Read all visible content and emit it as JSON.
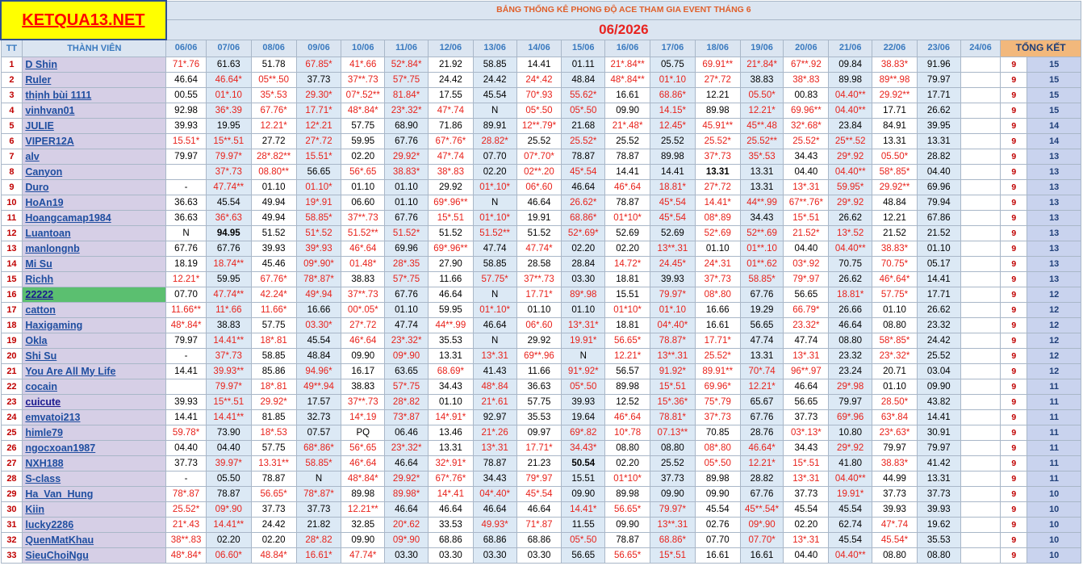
{
  "logo_text": "KETQUA13.NET",
  "title": "BẢNG THỐNG KÊ PHONG ĐỘ ACE THAM GIA EVENT THÁNG 6",
  "month": "06/2026",
  "headers": {
    "tt": "TT",
    "member": "THÀNH VIÊN",
    "dates": [
      "06/06",
      "07/06",
      "08/06",
      "09/06",
      "10/06",
      "11/06",
      "12/06",
      "13/06",
      "14/06",
      "15/06",
      "16/06",
      "17/06",
      "18/06",
      "19/06",
      "20/06",
      "21/06",
      "22/06",
      "23/06",
      "24/06"
    ],
    "total": "TỔNG KẾT"
  },
  "colors": {
    "logo_bg": "#ffff00",
    "logo_text": "#ff0000",
    "header_bg": "#dbe5f1",
    "name_bg": "#d6cfe6",
    "highlight_bg": "#5bbf70",
    "red_value": "#e8221b",
    "total_header_bg": "#f2b87c"
  },
  "rows": [
    {
      "tt": "1",
      "name": "D Shin",
      "values": [
        "71*.76",
        "61.63",
        "51.78",
        "67.85*",
        "41*.66",
        "52*.84*",
        "21.92",
        "58.85",
        "14.41",
        "01.11",
        "21*.84**",
        "05.75",
        "69.91**",
        "21*.84*",
        "67**.92",
        "09.84",
        "38.83*",
        "91.96",
        ""
      ],
      "t1": "9",
      "t2": "15"
    },
    {
      "tt": "2",
      "name": "Ruler",
      "values": [
        "46.64",
        "46.64*",
        "05**.50",
        "37.73",
        "37**.73",
        "57*.75",
        "24.42",
        "24.42",
        "24*.42",
        "48.84",
        "48*.84**",
        "01*.10",
        "27*.72",
        "38.83",
        "38*.83",
        "89.98",
        "89**.98",
        "79.97",
        ""
      ],
      "t1": "9",
      "t2": "15"
    },
    {
      "tt": "3",
      "name": "thịnh bùi 1111",
      "values": [
        "00.55",
        "01*.10",
        "35*.53",
        "29.30*",
        "07*.52**",
        "81.84*",
        "17.55",
        "45.54",
        "70*.93",
        "55.62*",
        "16.61",
        "68.86*",
        "12.21",
        "05.50*",
        "00.83",
        "04.40**",
        "29.92**",
        "17.71",
        ""
      ],
      "t1": "9",
      "t2": "15"
    },
    {
      "tt": "4",
      "name": "vinhvan01",
      "values": [
        "92.98",
        "36*.39",
        "67.76*",
        "17.71*",
        "48*.84*",
        "23*.32*",
        "47*.74",
        "N",
        "05*.50",
        "05*.50",
        "09.90",
        "14.15*",
        "89.98",
        "12.21*",
        "69.96**",
        "04.40**",
        "17.71",
        "26.62",
        ""
      ],
      "t1": "9",
      "t2": "15"
    },
    {
      "tt": "5",
      "name": "JULIE",
      "values": [
        "39.93",
        "19.95",
        "12.21*",
        "12*.21",
        "57.75",
        "68.90",
        "71.86",
        "89.91",
        "12**.79*",
        "21.68",
        "21*.48*",
        "12.45*",
        "45.91**",
        "45**.48",
        "32*.68*",
        "23.84",
        "84.91",
        "39.95",
        ""
      ],
      "t1": "9",
      "t2": "14"
    },
    {
      "tt": "6",
      "name": "VIPER12A",
      "values": [
        "15.51*",
        "15**.51",
        "27.72",
        "27*.72",
        "59.95",
        "67.76",
        "67*.76*",
        "28.82*",
        "25.52",
        "25.52*",
        "25.52",
        "25.52",
        "25.52*",
        "25.52**",
        "25.52*",
        "25**.52",
        "13.31",
        "13.31",
        ""
      ],
      "t1": "9",
      "t2": "14"
    },
    {
      "tt": "7",
      "name": "alv",
      "values": [
        "79.97",
        "79.97*",
        "28*.82**",
        "15.51*",
        "02.20",
        "29.92*",
        "47*.74",
        "07.70",
        "07*.70*",
        "78.87",
        "78.87",
        "89.98",
        "37*.73",
        "35*.53",
        "34.43",
        "29*.92",
        "05.50*",
        "28.82",
        ""
      ],
      "t1": "9",
      "t2": "13"
    },
    {
      "tt": "8",
      "name": "Canyon",
      "values": [
        "",
        "37*.73",
        "08.80**",
        "56.65",
        "56*.65",
        "38.83*",
        "38*.83",
        "02.20",
        "02**.20",
        "45*.54",
        "14.41",
        "14.41",
        "13.31",
        "13.31",
        "04.40",
        "04.40**",
        "58*.85*",
        "04.40",
        ""
      ],
      "t1": "9",
      "t2": "13"
    },
    {
      "tt": "9",
      "name": "Duro",
      "values": [
        "-",
        "47.74**",
        "01.10",
        "01.10*",
        "01.10",
        "01.10",
        "29.92",
        "01*.10*",
        "06*.60",
        "46.64",
        "46*.64",
        "18.81*",
        "27*.72",
        "13.31",
        "13*.31",
        "59.95*",
        "29.92**",
        "69.96",
        ""
      ],
      "t1": "9",
      "t2": "13"
    },
    {
      "tt": "10",
      "name": "HoAn19",
      "values": [
        "36.63",
        "45.54",
        "49.94",
        "19*.91",
        "06.60",
        "01.10",
        "69*.96**",
        "N",
        "46.64",
        "26.62*",
        "78.87",
        "45*.54",
        "14.41*",
        "44**.99",
        "67**.76*",
        "29*.92",
        "48.84",
        "79.94",
        ""
      ],
      "t1": "9",
      "t2": "13"
    },
    {
      "tt": "11",
      "name": "Hoangcamap1984",
      "values": [
        "36.63",
        "36*.63",
        "49.94",
        "58.85*",
        "37**.73",
        "67.76",
        "15*.51",
        "01*.10*",
        "19.91",
        "68.86*",
        "01*10*",
        "45*.54",
        "08*.89",
        "34.43",
        "15*.51",
        "26.62",
        "12.21",
        "67.86",
        ""
      ],
      "t1": "9",
      "t2": "13"
    },
    {
      "tt": "12",
      "name": "Luantoan",
      "values": [
        "N",
        "94.95",
        "51.52",
        "51*.52",
        "51.52**",
        "51.52*",
        "51.52",
        "51.52**",
        "51.52",
        "52*.69*",
        "52.69",
        "52.69",
        "52*.69",
        "52**.69",
        "21.52*",
        "13*.52",
        "21.52",
        "21.52",
        ""
      ],
      "t1": "9",
      "t2": "13"
    },
    {
      "tt": "13",
      "name": "manlongnb",
      "values": [
        "67.76",
        "67.76",
        "39.93",
        "39*.93",
        "46*.64",
        "69.96",
        "69*.96**",
        "47.74",
        "47.74*",
        "02.20",
        "02.20",
        "13**.31",
        "01.10",
        "01**.10",
        "04.40",
        "04.40**",
        "38.83*",
        "01.10",
        ""
      ],
      "t1": "9",
      "t2": "13"
    },
    {
      "tt": "14",
      "name": "Mi Su",
      "values": [
        "18.19",
        "18.74**",
        "45.46",
        "09*.90*",
        "01.48*",
        "28*.35",
        "27.90",
        "58.85",
        "28.58",
        "28.84",
        "14.72*",
        "24.45*",
        "24*.31",
        "01**.62",
        "03*.92",
        "70.75",
        "70.75*",
        "05.17",
        ""
      ],
      "t1": "9",
      "t2": "13"
    },
    {
      "tt": "15",
      "name": "Richh",
      "values": [
        "12.21*",
        "59.95",
        "67.76*",
        "78*.87*",
        "38.83",
        "57*.75",
        "11.66",
        "57.75*",
        "37**.73",
        "03.30",
        "18.81",
        "39.93",
        "37*.73",
        "58.85*",
        "79*.97",
        "26.62",
        "46*.64*",
        "14.41",
        ""
      ],
      "t1": "9",
      "t2": "13"
    },
    {
      "tt": "16",
      "name": "22222",
      "values": [
        "07.70",
        "47.74**",
        "42.24*",
        "49*.94",
        "37**.73",
        "67.76",
        "46.64",
        "N",
        "17.71*",
        "89*.98",
        "15.51",
        "79.97*",
        "08*.80",
        "67.76",
        "56.65",
        "18.81*",
        "57.75*",
        "17.71",
        ""
      ],
      "t1": "9",
      "t2": "12"
    },
    {
      "tt": "17",
      "name": "catton",
      "values": [
        "11.66**",
        "11*.66",
        "11.66*",
        "16.66",
        "00*.05*",
        "01.10",
        "59.95",
        "01*.10*",
        "01.10",
        "01.10",
        "01*10*",
        "01*.10",
        "16.66",
        "19.29",
        "66.79*",
        "26.66",
        "01.10",
        "26.62",
        ""
      ],
      "t1": "9",
      "t2": "12"
    },
    {
      "tt": "18",
      "name": "Haxigaming",
      "values": [
        "48*.84*",
        "38.83",
        "57.75",
        "03.30*",
        "27*.72",
        "47.74",
        "44**.99",
        "46.64",
        "06*.60",
        "13*.31*",
        "18.81",
        "04*.40*",
        "16.61",
        "56.65",
        "23.32*",
        "46.64",
        "08.80",
        "23.32",
        ""
      ],
      "t1": "9",
      "t2": "12"
    },
    {
      "tt": "19",
      "name": "Okla",
      "values": [
        "79.97",
        "14.41**",
        "18*.81",
        "45.54",
        "46*.64",
        "23*.32*",
        "35.53",
        "N",
        "29.92",
        "19.91*",
        "56.65*",
        "78.87*",
        "17.71*",
        "47.74",
        "47.74",
        "08.80",
        "58*.85*",
        "24.42",
        ""
      ],
      "t1": "9",
      "t2": "12"
    },
    {
      "tt": "20",
      "name": "Shi Su",
      "values": [
        "-",
        "37*.73",
        "58.85",
        "48.84",
        "09.90",
        "09*.90",
        "13.31",
        "13*.31",
        "69**.96",
        "N",
        "12.21*",
        "13**.31",
        "25.52*",
        "13.31",
        "13*.31",
        "23.32",
        "23*.32*",
        "25.52",
        ""
      ],
      "t1": "9",
      "t2": "12"
    },
    {
      "tt": "21",
      "name": "You Are All My Life",
      "values": [
        "14.41",
        "39.93**",
        "85.86",
        "94.96*",
        "16.17",
        "63.65",
        "68.69*",
        "41.43",
        "11.66",
        "91*.92*",
        "56.57",
        "91.92*",
        "89.91**",
        "70*.74",
        "96**.97",
        "23.24",
        "20.71",
        "03.04",
        ""
      ],
      "t1": "9",
      "t2": "12"
    },
    {
      "tt": "22",
      "name": "cocain",
      "values": [
        "",
        "79.97*",
        "18*.81",
        "49**.94",
        "38.83",
        "57*.75",
        "34.43",
        "48*.84",
        "36.63",
        "05*.50",
        "89.98",
        "15*.51",
        "69.96*",
        "12.21*",
        "46.64",
        "29*.98",
        "01.10",
        "09.90",
        ""
      ],
      "t1": "9",
      "t2": "11"
    },
    {
      "tt": "23",
      "name": "cuicute",
      "values": [
        "39.93",
        "15**.51",
        "29.92*",
        "17.57",
        "37**.73",
        "28*.82",
        "01.10",
        "21*.61",
        "57.75",
        "39.93",
        "12.52",
        "15*.36*",
        "75*.79",
        "65.67",
        "56.65",
        "79.97",
        "28.50*",
        "43.82",
        ""
      ],
      "t1": "9",
      "t2": "11"
    },
    {
      "tt": "24",
      "name": "emvatoi213",
      "values": [
        "14.41",
        "14.41**",
        "81.85",
        "32.73",
        "14*.19",
        "73*.87",
        "14*.91*",
        "92.97",
        "35.53",
        "19.64",
        "46*.64",
        "78.81*",
        "37*.73",
        "67.76",
        "37.73",
        "69*.96",
        "63*.84",
        "14.41",
        ""
      ],
      "t1": "9",
      "t2": "11"
    },
    {
      "tt": "25",
      "name": "himle79",
      "values": [
        "59.78*",
        "73.90",
        "18*.53",
        "07.57",
        "PQ",
        "06.46",
        "13.46",
        "21*.26",
        "09.97",
        "69*.82",
        "10*.78",
        "07.13**",
        "70.85",
        "28.76",
        "03*.13*",
        "10.80",
        "23*.63*",
        "30.91",
        ""
      ],
      "t1": "9",
      "t2": "11"
    },
    {
      "tt": "26",
      "name": "ngocxoan1987",
      "values": [
        "04.40",
        "04.40",
        "57.75",
        "68*.86*",
        "56*.65",
        "23*.32*",
        "13.31",
        "13*.31",
        "17.71*",
        "34.43*",
        "08.80",
        "08.80",
        "08*.80",
        "46.64*",
        "34.43",
        "29*.92",
        "79.97",
        "79.97",
        ""
      ],
      "t1": "9",
      "t2": "11"
    },
    {
      "tt": "27",
      "name": "NXH188",
      "values": [
        "37.73",
        "39.97*",
        "13.31**",
        "58.85*",
        "46*.64",
        "46.64",
        "32*.91*",
        "78.87",
        "21.23",
        "50.54",
        "02.20",
        "25.52",
        "05*.50",
        "12.21*",
        "15*.51",
        "41.80",
        "38.83*",
        "41.42",
        ""
      ],
      "t1": "9",
      "t2": "11"
    },
    {
      "tt": "28",
      "name": "S-class",
      "values": [
        "-",
        "05.50",
        "78.87",
        "N",
        "48*.84*",
        "29.92*",
        "67*.76*",
        "34.43",
        "79*.97",
        "15.51",
        "01*10*",
        "37.73",
        "89.98",
        "28.82",
        "13*.31",
        "04.40**",
        "44.99",
        "13.31",
        ""
      ],
      "t1": "9",
      "t2": "11"
    },
    {
      "tt": "29",
      "name": "Ha_Van_Hung",
      "values": [
        "78*.87",
        "78.87",
        "56.65*",
        "78*.87*",
        "89.98",
        "89.98*",
        "14*.41",
        "04*.40*",
        "45*.54",
        "09.90",
        "89.98",
        "09.90",
        "09.90",
        "67.76",
        "37.73",
        "19.91*",
        "37.73",
        "37.73",
        ""
      ],
      "t1": "9",
      "t2": "10"
    },
    {
      "tt": "30",
      "name": "Kiin",
      "values": [
        "25.52*",
        "09*.90",
        "37.73",
        "37.73",
        "12.21**",
        "46.64",
        "46.64",
        "46.64",
        "46.64",
        "14.41*",
        "56.65*",
        "79.97*",
        "45.54",
        "45**.54*",
        "45.54",
        "45.54",
        "39.93",
        "39.93",
        ""
      ],
      "t1": "9",
      "t2": "10"
    },
    {
      "tt": "31",
      "name": "lucky2286",
      "values": [
        "21*.43",
        "14.41**",
        "24.42",
        "21.82",
        "32.85",
        "20*.62",
        "33.53",
        "49.93*",
        "71*.87",
        "11.55",
        "09.90",
        "13**.31",
        "02.76",
        "09*.90",
        "02.20",
        "62.74",
        "47*.74",
        "19.62",
        ""
      ],
      "t1": "9",
      "t2": "10"
    },
    {
      "tt": "32",
      "name": "QuenMatKhau",
      "values": [
        "38**.83",
        "02.20",
        "02.20",
        "28*.82",
        "09.90",
        "09*.90",
        "68.86",
        "68.86",
        "68.86",
        "05*.50",
        "78.87",
        "68.86*",
        "07.70",
        "07.70*",
        "13*.31",
        "45.54",
        "45.54*",
        "35.53",
        ""
      ],
      "t1": "9",
      "t2": "10"
    },
    {
      "tt": "33",
      "name": "SieuChoiNgu",
      "values": [
        "48*.84*",
        "06.60*",
        "48.84*",
        "16.61*",
        "47.74*",
        "03.30",
        "03.30",
        "03.30",
        "03.30",
        "56.65",
        "56.65*",
        "15*.51",
        "16.61",
        "16.61",
        "04.40",
        "04.40**",
        "08.80",
        "08.80",
        ""
      ],
      "t1": "9",
      "t2": "10"
    }
  ]
}
